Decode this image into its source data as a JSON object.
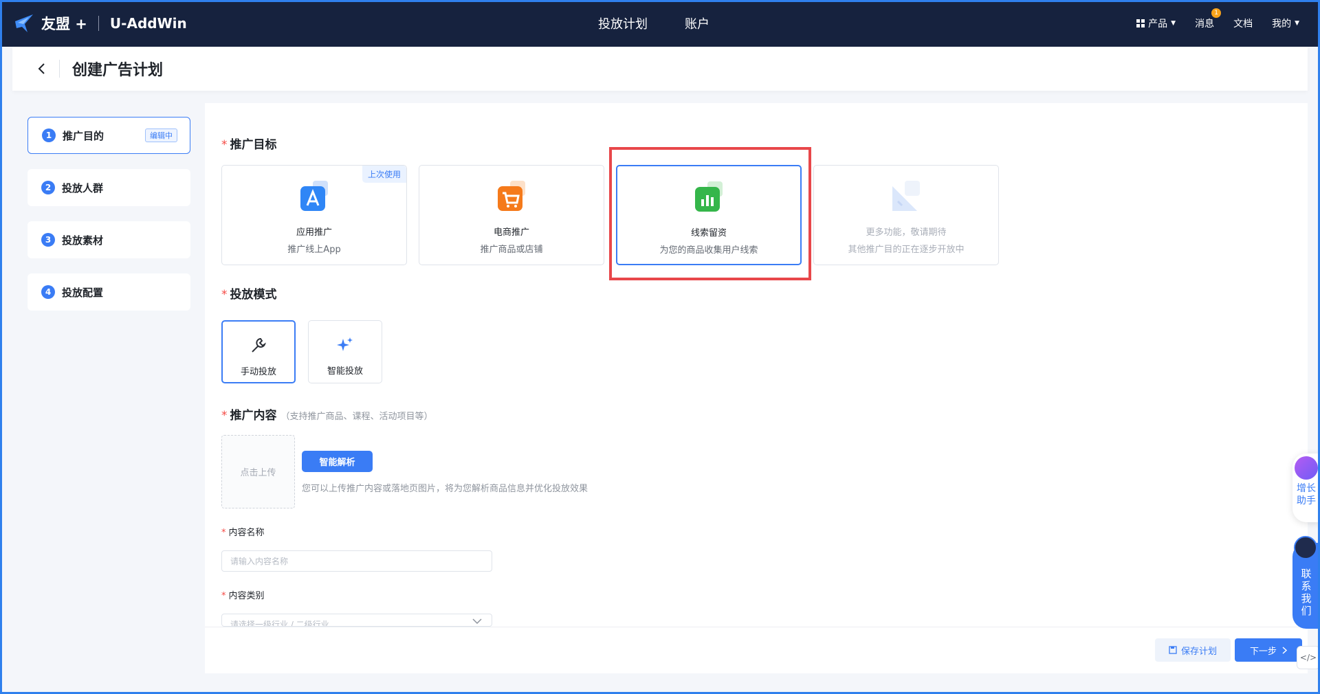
{
  "brand": {
    "name": "友盟 +",
    "product": "U-AddWin"
  },
  "topnav": {
    "plan": "投放计划",
    "account": "账户"
  },
  "rightnav": {
    "products": "产品",
    "messages": "消息",
    "messages_badge": "1",
    "docs": "文档",
    "mine": "我的"
  },
  "page": {
    "title": "创建广告计划"
  },
  "steps": [
    {
      "num": "1",
      "label": "推广目的",
      "tag": "编辑中"
    },
    {
      "num": "2",
      "label": "投放人群"
    },
    {
      "num": "3",
      "label": "投放素材"
    },
    {
      "num": "4",
      "label": "投放配置"
    }
  ],
  "goal_section": {
    "title": "推广目标"
  },
  "goals": [
    {
      "name": "应用推广",
      "desc": "推广线上App",
      "tag": "上次使用",
      "icon": "app-store-icon"
    },
    {
      "name": "电商推广",
      "desc": "推广商品或店铺",
      "icon": "shopping-cart-icon"
    },
    {
      "name": "线索留资",
      "desc": "为您的商品收集用户线索",
      "icon": "leads-chart-icon"
    },
    {
      "name": "更多功能，敬请期待",
      "desc": "其他推广目的正在逐步开放中",
      "icon": "more-features-icon"
    }
  ],
  "mode_section": {
    "title": "投放模式"
  },
  "modes": [
    {
      "label": "手动投放",
      "icon": "wrench-icon"
    },
    {
      "label": "智能投放",
      "icon": "sparkle-icon"
    }
  ],
  "content_section": {
    "title": "推广内容",
    "hint": "（支持推广商品、课程、活动项目等）"
  },
  "upload": {
    "label": "点击上传",
    "parse_button": "智能解析",
    "tip": "您可以上传推广内容或落地页图片，将为您解析商品信息并优化投放效果"
  },
  "fields": {
    "name_label": "内容名称",
    "name_placeholder": "请输入内容名称",
    "category_label": "内容类别",
    "category_placeholder": "请选择一级行业 / 二级行业"
  },
  "footer": {
    "save": "保存计划",
    "next": "下一步"
  },
  "floating": {
    "growth": "增长助手",
    "contact": "联系我们"
  },
  "colors": {
    "primary": "#3a7cf5",
    "topbar": "#16223e",
    "highlight": "#e8474a"
  }
}
